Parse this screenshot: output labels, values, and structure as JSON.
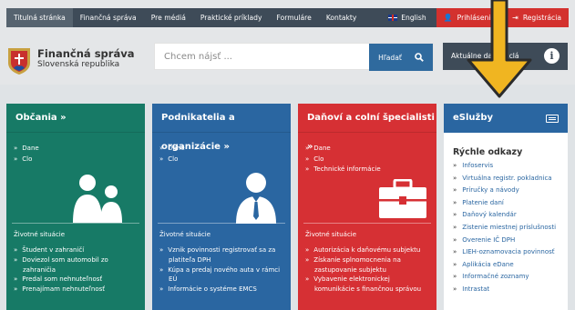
{
  "nav": {
    "items": [
      "Titulná stránka",
      "Finančná správa",
      "Pre médiá",
      "Praktické príklady",
      "Formuláre",
      "Kontakty"
    ],
    "english": "English",
    "login": "Prihlásenie",
    "register": "Registrácia"
  },
  "brand": {
    "line1": "Finančná správa",
    "line2": "Slovenská republika"
  },
  "search": {
    "placeholder": "Chcem nájsť ...",
    "button": "Hľadať"
  },
  "news": {
    "label": "Aktuálne dane a clá"
  },
  "columns": {
    "citizens": {
      "title": "Občania »",
      "links": [
        "Dane",
        "Clo"
      ],
      "situations": "Životné situácie",
      "sitlist": [
        "Študent v zahraničí",
        "Doviezol som automobil zo zahraničia",
        "Predal som nehnuteľnosť",
        "Prenajímam nehnuteľnosť"
      ]
    },
    "business": {
      "title": "Podnikatelia a organizácie »",
      "links": [
        "Dane",
        "Clo"
      ],
      "situations": "Životné situácie",
      "sitlist": [
        "Vznik povinnosti registrovať sa za platiteľa DPH",
        "Kúpa a predaj nového auta v rámci EÚ",
        "Informácie o systéme EMCS"
      ]
    },
    "specialists": {
      "title": "Daňoví a colní špecialisti »",
      "links": [
        "Dane",
        "Clo",
        "Technické informácie"
      ],
      "situations": "Životné situácie",
      "sitlist": [
        "Autorizácia k daňovému subjektu",
        "Získanie splnomocnenia na zastupovanie subjektu",
        "Vybavenie elektronickej komunikácie s finančnou správou"
      ]
    },
    "eservices": {
      "title": "eSlužby",
      "quick_title": "Rýchle odkazy",
      "links": [
        "Infoservis",
        "Virtuálna registr. pokladnica",
        "Príručky a návody",
        "Platenie daní",
        "Daňový kalendár",
        "Zistenie miestnej príslušnosti",
        "Overenie IČ DPH",
        "LIEH-oznamovacia povinnosť",
        "Aplikácia eDane",
        "Informačné zoznamy",
        "Intrastat"
      ]
    }
  },
  "colors": {
    "green": "#177a66",
    "blue": "#2a66a1",
    "red": "#d63034",
    "nav": "#3e4b58",
    "arrow": "#f0b521"
  }
}
